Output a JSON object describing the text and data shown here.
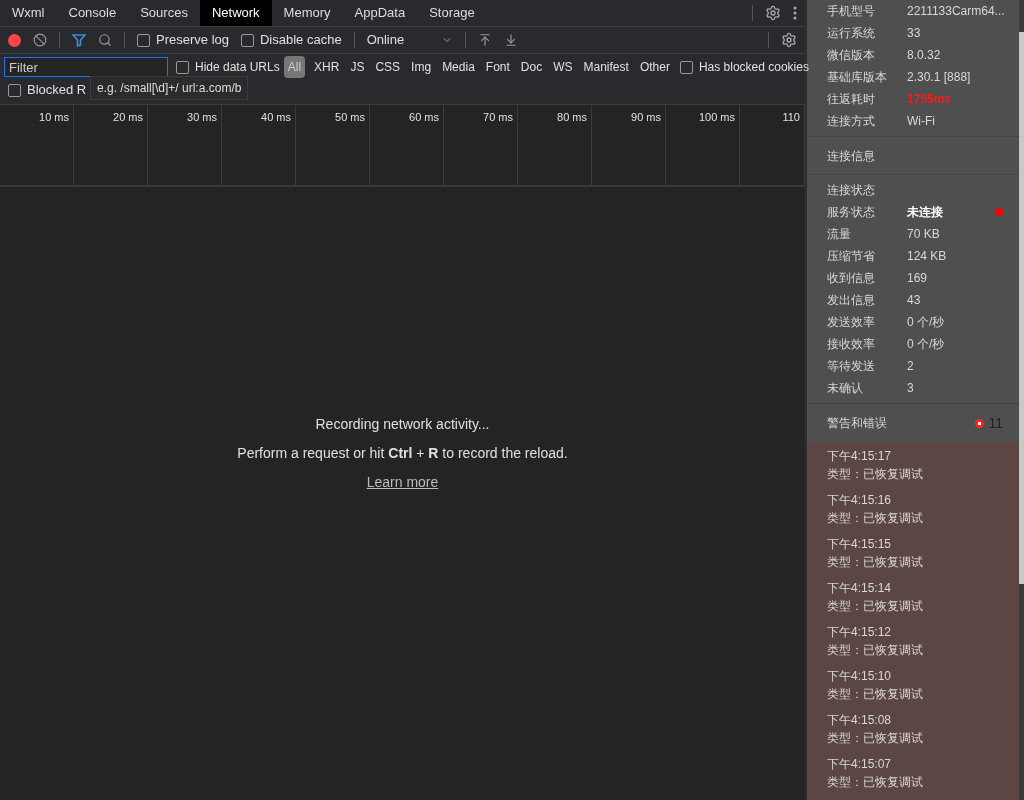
{
  "tabs": [
    {
      "label": "Wxml",
      "selected": false
    },
    {
      "label": "Console",
      "selected": false
    },
    {
      "label": "Sources",
      "selected": false
    },
    {
      "label": "Network",
      "selected": true
    },
    {
      "label": "Memory",
      "selected": false
    },
    {
      "label": "AppData",
      "selected": false
    },
    {
      "label": "Storage",
      "selected": false
    }
  ],
  "toolbar": {
    "recording": true,
    "preserve_log": {
      "label": "Preserve log",
      "checked": false
    },
    "disable_cache": {
      "label": "Disable cache",
      "checked": false
    },
    "throttling": "Online"
  },
  "filter_bar": {
    "filter": {
      "placeholder": "Filter"
    },
    "hide_data_urls": {
      "label": "Hide data URLs",
      "checked": false
    },
    "types": [
      {
        "label": "All",
        "selected": true
      },
      {
        "label": "XHR",
        "selected": false
      },
      {
        "label": "JS",
        "selected": false
      },
      {
        "label": "CSS",
        "selected": false
      },
      {
        "label": "Img",
        "selected": false
      },
      {
        "label": "Media",
        "selected": false
      },
      {
        "label": "Font",
        "selected": false
      },
      {
        "label": "Doc",
        "selected": false
      },
      {
        "label": "WS",
        "selected": false
      },
      {
        "label": "Manifest",
        "selected": false
      },
      {
        "label": "Other",
        "selected": false
      }
    ],
    "has_blocked_cookies": {
      "label": "Has blocked cookies",
      "checked": false
    },
    "blocked_requests": {
      "label": "Blocked R",
      "checked": false
    },
    "tooltip": "e.g. /small[\\d]+/ url:a.com/b"
  },
  "timeline": {
    "ticks": [
      "10 ms",
      "20 ms",
      "30 ms",
      "40 ms",
      "50 ms",
      "60 ms",
      "70 ms",
      "80 ms",
      "90 ms",
      "100 ms",
      "110"
    ]
  },
  "empty_state": {
    "title": "Recording network activity...",
    "hint": "Perform a request or hit **Ctrl** + **R** to record the reload.",
    "link": "Learn more"
  },
  "device_info": [
    {
      "label": "手机型号",
      "value": "2211133Carm64...",
      "alert": false
    },
    {
      "label": "运行系统",
      "value": "33",
      "alert": false
    },
    {
      "label": "微信版本",
      "value": "8.0.32",
      "alert": false
    },
    {
      "label": "基础库版本",
      "value": "2.30.1 [888]",
      "alert": false
    },
    {
      "label": "往返耗时",
      "value": "1755ms",
      "alert": true
    },
    {
      "label": "连接方式",
      "value": "Wi-Fi",
      "alert": false
    }
  ],
  "connection_title": "连接信息",
  "connection_stats": {
    "title": "连接状态",
    "rows": [
      {
        "label": "服务状态",
        "value": "未连接",
        "color": "#ff0000"
      },
      {
        "label": "流量",
        "value": "70 KB"
      },
      {
        "label": "压缩节省",
        "value": "124 KB"
      },
      {
        "label": "收到信息",
        "value": "169"
      },
      {
        "label": "发出信息",
        "value": "43"
      },
      {
        "label": "发送效率",
        "value": "0 个/秒"
      },
      {
        "label": "接收效率",
        "value": "0 个/秒"
      },
      {
        "label": "等待发送",
        "value": "2"
      },
      {
        "label": "未确认",
        "value": "3"
      }
    ]
  },
  "warnings": {
    "title": "警告和错误",
    "count": "11"
  },
  "logs": [
    {
      "time": "下午4:15:17",
      "type": "类型：已恢复调试"
    },
    {
      "time": "下午4:15:16",
      "type": "类型：已恢复调试"
    },
    {
      "time": "下午4:15:15",
      "type": "类型：已恢复调试"
    },
    {
      "time": "下午4:15:14",
      "type": "类型：已恢复调试"
    },
    {
      "time": "下午4:15:12",
      "type": "类型：已恢复调试"
    },
    {
      "time": "下午4:15:10",
      "type": "类型：已恢复调试"
    },
    {
      "time": "下午4:15:08",
      "type": "类型：已恢复调试"
    },
    {
      "time": "下午4:15:07",
      "type": "类型：已恢复调试"
    }
  ]
}
